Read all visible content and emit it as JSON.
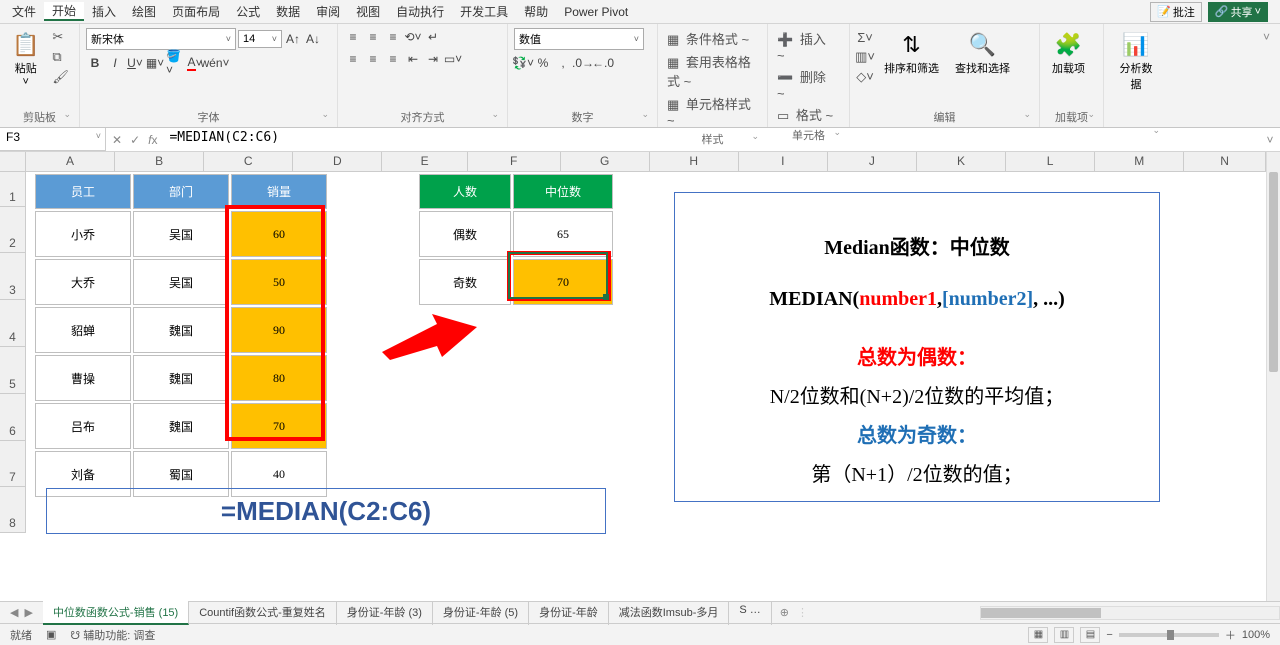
{
  "menu": {
    "items": [
      "文件",
      "开始",
      "插入",
      "绘图",
      "页面布局",
      "公式",
      "数据",
      "审阅",
      "视图",
      "自动执行",
      "开发工具",
      "帮助",
      "Power Pivot"
    ],
    "active": 1,
    "comment": "批注",
    "share": "共享"
  },
  "ribbon": {
    "clipboard": {
      "paste": "粘贴",
      "label": "剪贴板"
    },
    "font": {
      "name": "新宋体",
      "size": "14",
      "label": "字体"
    },
    "align": {
      "label": "对齐方式"
    },
    "number": {
      "format": "数值",
      "label": "数字"
    },
    "styles": {
      "cf": "条件格式 ~",
      "tf": "套用表格格式 ~",
      "cs": "单元格样式 ~",
      "label": "样式"
    },
    "cells": {
      "ins": "插入 ~",
      "del": "删除 ~",
      "fmt": "格式 ~",
      "label": "单元格"
    },
    "editing": {
      "sort": "排序和筛选",
      "find": "查找和选择",
      "label": "编辑"
    },
    "addins": {
      "btn": "加载项",
      "label": "加载项"
    },
    "analysis": {
      "btn": "分析数据"
    }
  },
  "nameBox": "F3",
  "formula": "=MEDIAN(C2:C6)",
  "columns": [
    "A",
    "B",
    "C",
    "D",
    "E",
    "F",
    "G",
    "H",
    "I",
    "J",
    "K",
    "L",
    "M",
    "N"
  ],
  "employees": {
    "headers": [
      "员工",
      "部门",
      "销量"
    ],
    "rows": [
      [
        "小乔",
        "吴国",
        "60"
      ],
      [
        "大乔",
        "吴国",
        "50"
      ],
      [
        "貂蝉",
        "魏国",
        "90"
      ],
      [
        "曹操",
        "魏国",
        "80"
      ],
      [
        "吕布",
        "魏国",
        "70"
      ],
      [
        "刘备",
        "蜀国",
        "40"
      ]
    ]
  },
  "median": {
    "headers": [
      "人数",
      "中位数"
    ],
    "rows": [
      [
        "偶数",
        "65"
      ],
      [
        "奇数",
        "70"
      ]
    ]
  },
  "formulaDisplay": "=MEDIAN(C2:C6)",
  "info": {
    "title": "Median函数：中位数",
    "syntax_pre": "MEDIAN(",
    "syntax_n1": "number1",
    "syntax_sep1": ",",
    "syntax_n2": "[number2]",
    "syntax_post": ", ...)",
    "even_t": "总数为偶数：",
    "even_d": "N/2位数和(N+2)/2位数的平均值；",
    "odd_t": "总数为奇数：",
    "odd_d": "第（N+1）/2位数的值；"
  },
  "tabs": {
    "items": [
      "中位数函数公式-销售 (15)",
      "Countif函数公式-重复姓名",
      "身份证-年龄 (3)",
      "身份证-年龄 (5)",
      "身份证-年龄",
      "减法函数Imsub-多月",
      "S …"
    ],
    "active": 0
  },
  "status": {
    "ready": "就绪",
    "a11y": "辅助功能: 调查",
    "zoom": "100%"
  },
  "chart_data": {
    "type": "table",
    "title": "MEDIAN function example",
    "categories": [
      "小乔",
      "大乔",
      "貂蝉",
      "曹操",
      "吕布",
      "刘备"
    ],
    "series": [
      {
        "name": "部门",
        "values": [
          "吴国",
          "吴国",
          "魏国",
          "魏国",
          "魏国",
          "蜀国"
        ]
      },
      {
        "name": "销量",
        "values": [
          60,
          50,
          90,
          80,
          70,
          40
        ]
      }
    ],
    "median_even_count_result": 65,
    "median_odd_count_result_C2_C6": 70
  }
}
